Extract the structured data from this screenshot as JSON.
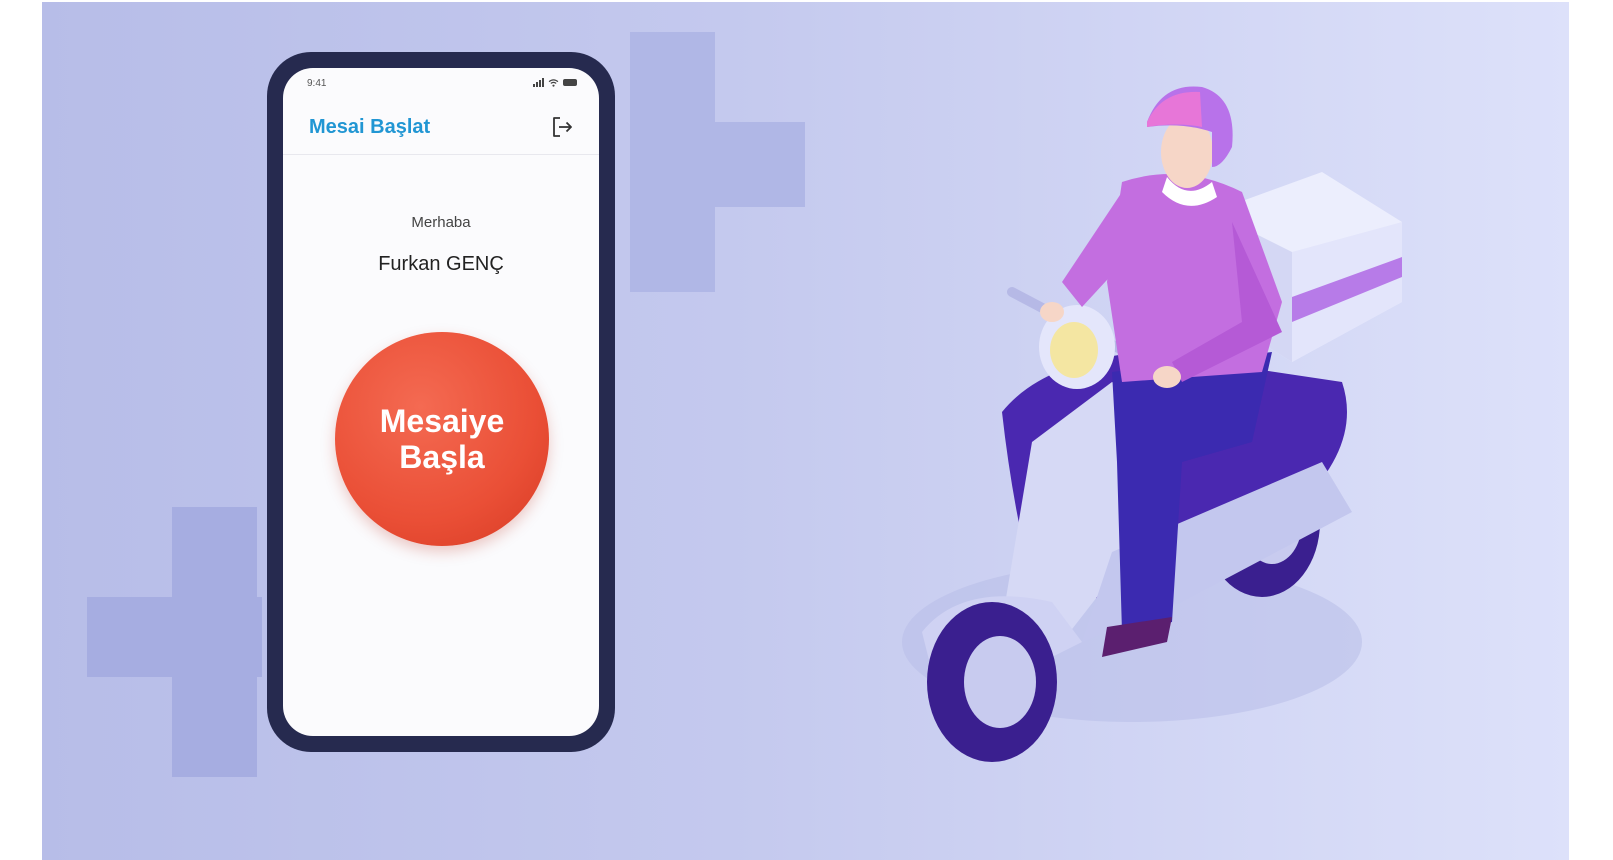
{
  "colors": {
    "background_start": "#b7bde8",
    "background_end": "#dde1fa",
    "phone_frame": "#262a4f",
    "title_blue": "#2196d3",
    "start_button_red": "#ea4f36",
    "rider_shirt": "#c36ee0",
    "rider_pants": "#3b2ab0",
    "scooter_body": "#c8cbef"
  },
  "phone": {
    "status_time": "9:41",
    "status_icons": [
      "cellular-signal-icon",
      "wifi-icon",
      "battery-icon"
    ],
    "appbar": {
      "title": "Mesai Başlat",
      "logout_icon": "logout-icon"
    },
    "greeting": "Merhaba",
    "user_name": "Furkan GENÇ",
    "start_button": {
      "line1": "Mesaiye",
      "line2": "Başla"
    }
  },
  "illustration": {
    "subject": "courier-on-scooter-illustration"
  }
}
